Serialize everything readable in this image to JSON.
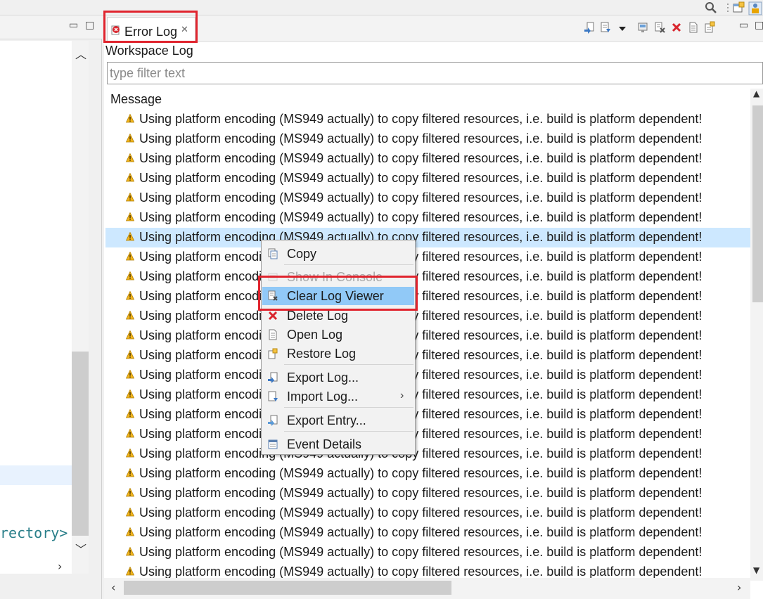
{
  "left_pane": {
    "code_fragment": "rectory>"
  },
  "tab": {
    "label": "Error Log",
    "close_glyph": "✕"
  },
  "toolbar_icons": [
    "export-log-icon",
    "import-log-icon",
    "view-menu-icon",
    "activate-on-new-events-icon",
    "clear-log-icon",
    "delete-log-icon",
    "open-log-icon",
    "restore-log-icon",
    "minimize-icon",
    "maximize-icon"
  ],
  "view": {
    "workspace_label": "Workspace Log",
    "filter_placeholder": "type filter text",
    "column_header": "Message"
  },
  "log_rows": [
    {
      "message": "Using platform encoding (MS949 actually) to copy filtered resources, i.e. build is platform dependent!",
      "severity": "warning"
    },
    {
      "message": "Using platform encoding (MS949 actually) to copy filtered resources, i.e. build is platform dependent!",
      "severity": "warning"
    },
    {
      "message": "Using platform encoding (MS949 actually) to copy filtered resources, i.e. build is platform dependent!",
      "severity": "warning"
    },
    {
      "message": "Using platform encoding (MS949 actually) to copy filtered resources, i.e. build is platform dependent!",
      "severity": "warning"
    },
    {
      "message": "Using platform encoding (MS949 actually) to copy filtered resources, i.e. build is platform dependent!",
      "severity": "warning"
    },
    {
      "message": "Using platform encoding (MS949 actually) to copy filtered resources, i.e. build is platform dependent!",
      "severity": "warning"
    },
    {
      "message": "Using platform encoding (MS949 actually) to copy filtered resources, i.e. build is platform dependent!",
      "severity": "warning",
      "selected": true
    },
    {
      "message": "Using platform encoding (MS949 actually) to copy filtered resources, i.e. build is platform dependent!",
      "severity": "warning"
    },
    {
      "message": "Using platform encoding (MS949 actually) to copy filtered resources, i.e. build is platform dependent!",
      "severity": "warning"
    },
    {
      "message": "Using platform encoding (MS949 actually) to copy filtered resources, i.e. build is platform dependent!",
      "severity": "warning"
    },
    {
      "message": "Using platform encoding (MS949 actually) to copy filtered resources, i.e. build is platform dependent!",
      "severity": "warning"
    },
    {
      "message": "Using platform encoding (MS949 actually) to copy filtered resources, i.e. build is platform dependent!",
      "severity": "warning"
    },
    {
      "message": "Using platform encoding (MS949 actually) to copy filtered resources, i.e. build is platform dependent!",
      "severity": "warning"
    },
    {
      "message": "Using platform encoding (MS949 actually) to copy filtered resources, i.e. build is platform dependent!",
      "severity": "warning"
    },
    {
      "message": "Using platform encoding (MS949 actually) to copy filtered resources, i.e. build is platform dependent!",
      "severity": "warning"
    },
    {
      "message": "Using platform encoding (MS949 actually) to copy filtered resources, i.e. build is platform dependent!",
      "severity": "warning"
    },
    {
      "message": "Using platform encoding (MS949 actually) to copy filtered resources, i.e. build is platform dependent!",
      "severity": "warning"
    },
    {
      "message": "Using platform encoding (MS949 actually) to copy filtered resources, i.e. build is platform dependent!",
      "severity": "warning"
    },
    {
      "message": "Using platform encoding (MS949 actually) to copy filtered resources, i.e. build is platform dependent!",
      "severity": "warning"
    },
    {
      "message": "Using platform encoding (MS949 actually) to copy filtered resources, i.e. build is platform dependent!",
      "severity": "warning"
    },
    {
      "message": "Using platform encoding (MS949 actually) to copy filtered resources, i.e. build is platform dependent!",
      "severity": "warning"
    },
    {
      "message": "Using platform encoding (MS949 actually) to copy filtered resources, i.e. build is platform dependent!",
      "severity": "warning"
    },
    {
      "message": "Using platform encoding (MS949 actually) to copy filtered resources, i.e. build is platform dependent!",
      "severity": "warning"
    },
    {
      "message": "Using platform encoding (MS949 actually) to copy filtered resources, i.e. build is platform dependent!",
      "severity": "warning"
    }
  ],
  "context_menu": {
    "items": [
      {
        "label": "Copy",
        "icon": "copy-icon",
        "enabled": true
      },
      {
        "label": "Show In Console",
        "icon": "console-icon",
        "enabled": false
      },
      {
        "label": "Clear Log Viewer",
        "icon": "clear-log-icon",
        "enabled": true,
        "highlighted": true
      },
      {
        "label": "Delete Log",
        "icon": "delete-icon",
        "enabled": true
      },
      {
        "label": "Open Log",
        "icon": "open-log-icon",
        "enabled": true
      },
      {
        "label": "Restore Log",
        "icon": "restore-log-icon",
        "enabled": true
      },
      {
        "label": "Export Log...",
        "icon": "export-log-icon",
        "enabled": true
      },
      {
        "label": "Import Log...",
        "icon": "import-log-icon",
        "enabled": true,
        "submenu": true
      },
      {
        "label": "Export Entry...",
        "icon": "export-entry-icon",
        "enabled": true
      },
      {
        "label": "Event Details",
        "icon": "event-details-icon",
        "enabled": true
      }
    ]
  },
  "colors": {
    "highlight_box": "#e0242e",
    "selection": "#cde8ff",
    "menu_highlight": "#91c9f7",
    "warning": "#e8a400"
  }
}
